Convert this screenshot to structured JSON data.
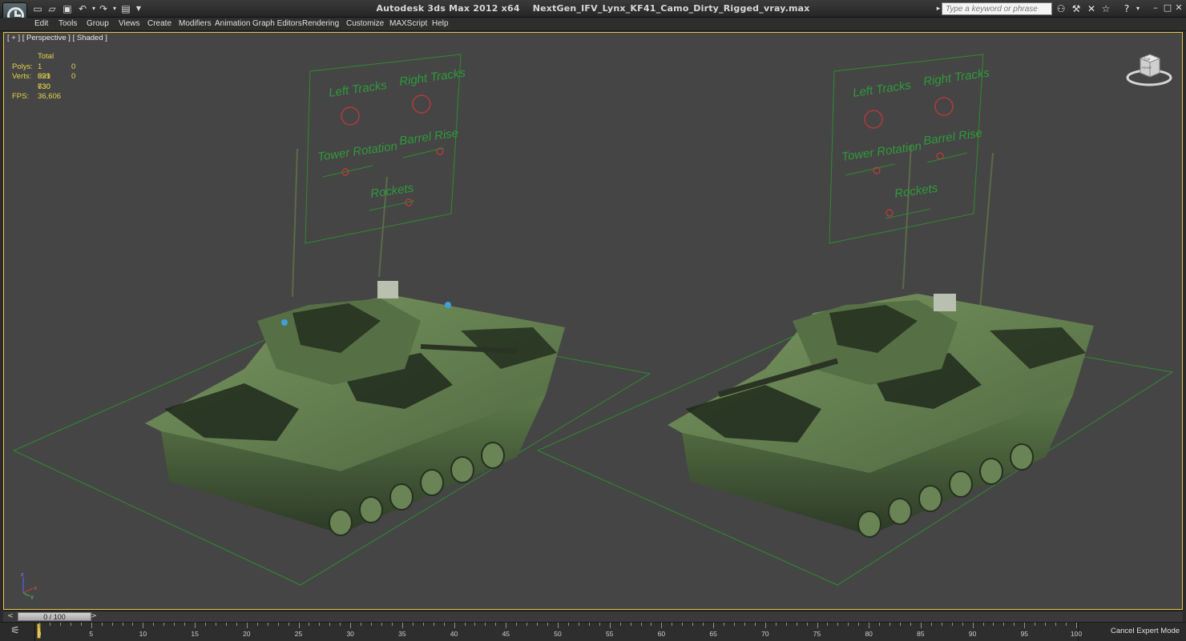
{
  "app": {
    "title": "Autodesk 3ds Max  2012 x64",
    "filename": "NextGen_IFV_Lynx_KF41_Camo_Dirty_Rigged_vray.max",
    "search_placeholder": "Type a keyword or phrase"
  },
  "quick_access": [
    "new-icon",
    "open-icon",
    "save-icon",
    "undo-icon",
    "redo-icon",
    "project-folder-icon",
    "dropdown-icon"
  ],
  "menu": {
    "items": [
      "Edit",
      "Tools",
      "Group",
      "Views",
      "Create",
      "Modifiers",
      "Animation",
      "Graph Editors",
      "Rendering",
      "Customize",
      "MAXScript",
      "Help"
    ]
  },
  "viewport": {
    "label": "[ + ] [ Perspective ] [ Shaded ]",
    "stats": {
      "header": "Total",
      "polys_label": "Polys:",
      "polys_value": "1 321 630",
      "polys_sel": "0",
      "verts_label": "Verts:",
      "verts_value": "699 730",
      "verts_sel": "0",
      "fps_label": "FPS:",
      "fps_value": "36,606"
    },
    "rig_labels": {
      "left_tracks": "Left Tracks",
      "right_tracks": "Right Tracks",
      "tower_rotation": "Tower Rotation",
      "barrel_rise": "Barrel Rise",
      "rockets": "Rockets"
    },
    "viewcube_labels": {
      "top": "TOP",
      "front": "FRONT"
    },
    "axis": {
      "x": "x",
      "y": "y",
      "z": "z"
    }
  },
  "timeline": {
    "slider_text": "0 / 100",
    "prev": "<",
    "next": ">"
  },
  "trackbar": {
    "ticks": [
      "0",
      "5",
      "10",
      "15",
      "20",
      "25",
      "30",
      "35",
      "40",
      "45",
      "50",
      "55",
      "60",
      "65",
      "70",
      "75",
      "80",
      "85",
      "90",
      "95",
      "100"
    ],
    "cancel_expert": "Cancel Expert Mode"
  },
  "colors": {
    "grid_green": "#2f8a2f",
    "rig_text": "#2f9a3a",
    "rig_circle": "#b23a3a",
    "stats_yellow": "#e2d44a",
    "viewport_bg": "#454545",
    "camo_light": "#6d8a55",
    "camo_dark": "#1f2a1c"
  }
}
